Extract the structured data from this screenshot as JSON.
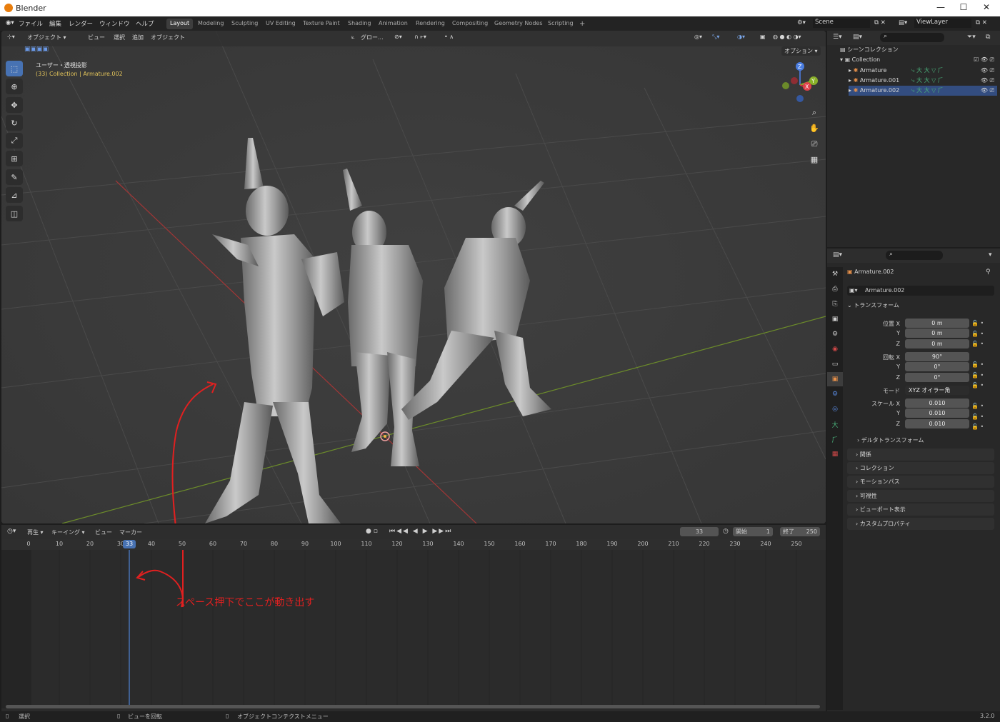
{
  "window": {
    "title": "Blender"
  },
  "menu": [
    "ファイル",
    "編集",
    "レンダー",
    "ウィンドウ",
    "ヘルプ"
  ],
  "workspaces": [
    "Layout",
    "Modeling",
    "Sculpting",
    "UV Editing",
    "Texture Paint",
    "Shading",
    "Animation",
    "Rendering",
    "Compositing",
    "Geometry Nodes",
    "Scripting",
    "+"
  ],
  "scene": {
    "scene_name": "Scene",
    "view_layer": "ViewLayer"
  },
  "viewport": {
    "header": {
      "mode": "オブジェクト ▾",
      "menus": [
        "ビュー",
        "選択",
        "追加",
        "オブジェクト"
      ],
      "transform": "グロー...",
      "options": "オプション ▾"
    },
    "overlay_title": "ユーザー・透視投影",
    "overlay_sub": "(33) Collection | Armature.002",
    "gizmo": {
      "x": "X",
      "y": "Y",
      "z": "Z"
    }
  },
  "annotation": {
    "text": "スペース押下でここが動き出す",
    "color": "#e02020"
  },
  "outliner": {
    "title": "シーンコレクション",
    "collection": "Collection",
    "items": [
      "Armature",
      "Armature.001",
      "Armature.002"
    ]
  },
  "properties": {
    "object_name": "Armature.002",
    "data_name": "Armature.002",
    "transform_header": "トランスフォーム",
    "loc_label": "位置 X",
    "y_label": "Y",
    "z_label": "Z",
    "loc": [
      "0 m",
      "0 m",
      "0 m"
    ],
    "rot_label": "回転 X",
    "rot": [
      "90°",
      "0°",
      "0°"
    ],
    "mode_label": "モード",
    "mode_value": "XYZ オイラー角",
    "scale_label": "スケール X",
    "scale": [
      "0.010",
      "0.010",
      "0.010"
    ],
    "delta": "デルタトランスフォーム",
    "panels": [
      "関係",
      "コレクション",
      "モーションパス",
      "可視性",
      "ビューポート表示",
      "カスタムプロパティ"
    ]
  },
  "timeline": {
    "menus": [
      "再生",
      "キーイング",
      "ビュー",
      "マーカー"
    ],
    "current_frame": "33",
    "start_label": "開始",
    "start": "1",
    "end_label": "終了",
    "end": "250",
    "ticks": [
      "0",
      "10",
      "20",
      "30",
      "40",
      "50",
      "60",
      "70",
      "80",
      "90",
      "100",
      "110",
      "120",
      "130",
      "140",
      "150",
      "160",
      "170",
      "180",
      "190",
      "200",
      "210",
      "220",
      "230",
      "240",
      "250"
    ]
  },
  "status": {
    "select": "選択",
    "rotate": "ビューを回転",
    "context": "オブジェクトコンテクストメニュー",
    "version": "3.2.0"
  }
}
